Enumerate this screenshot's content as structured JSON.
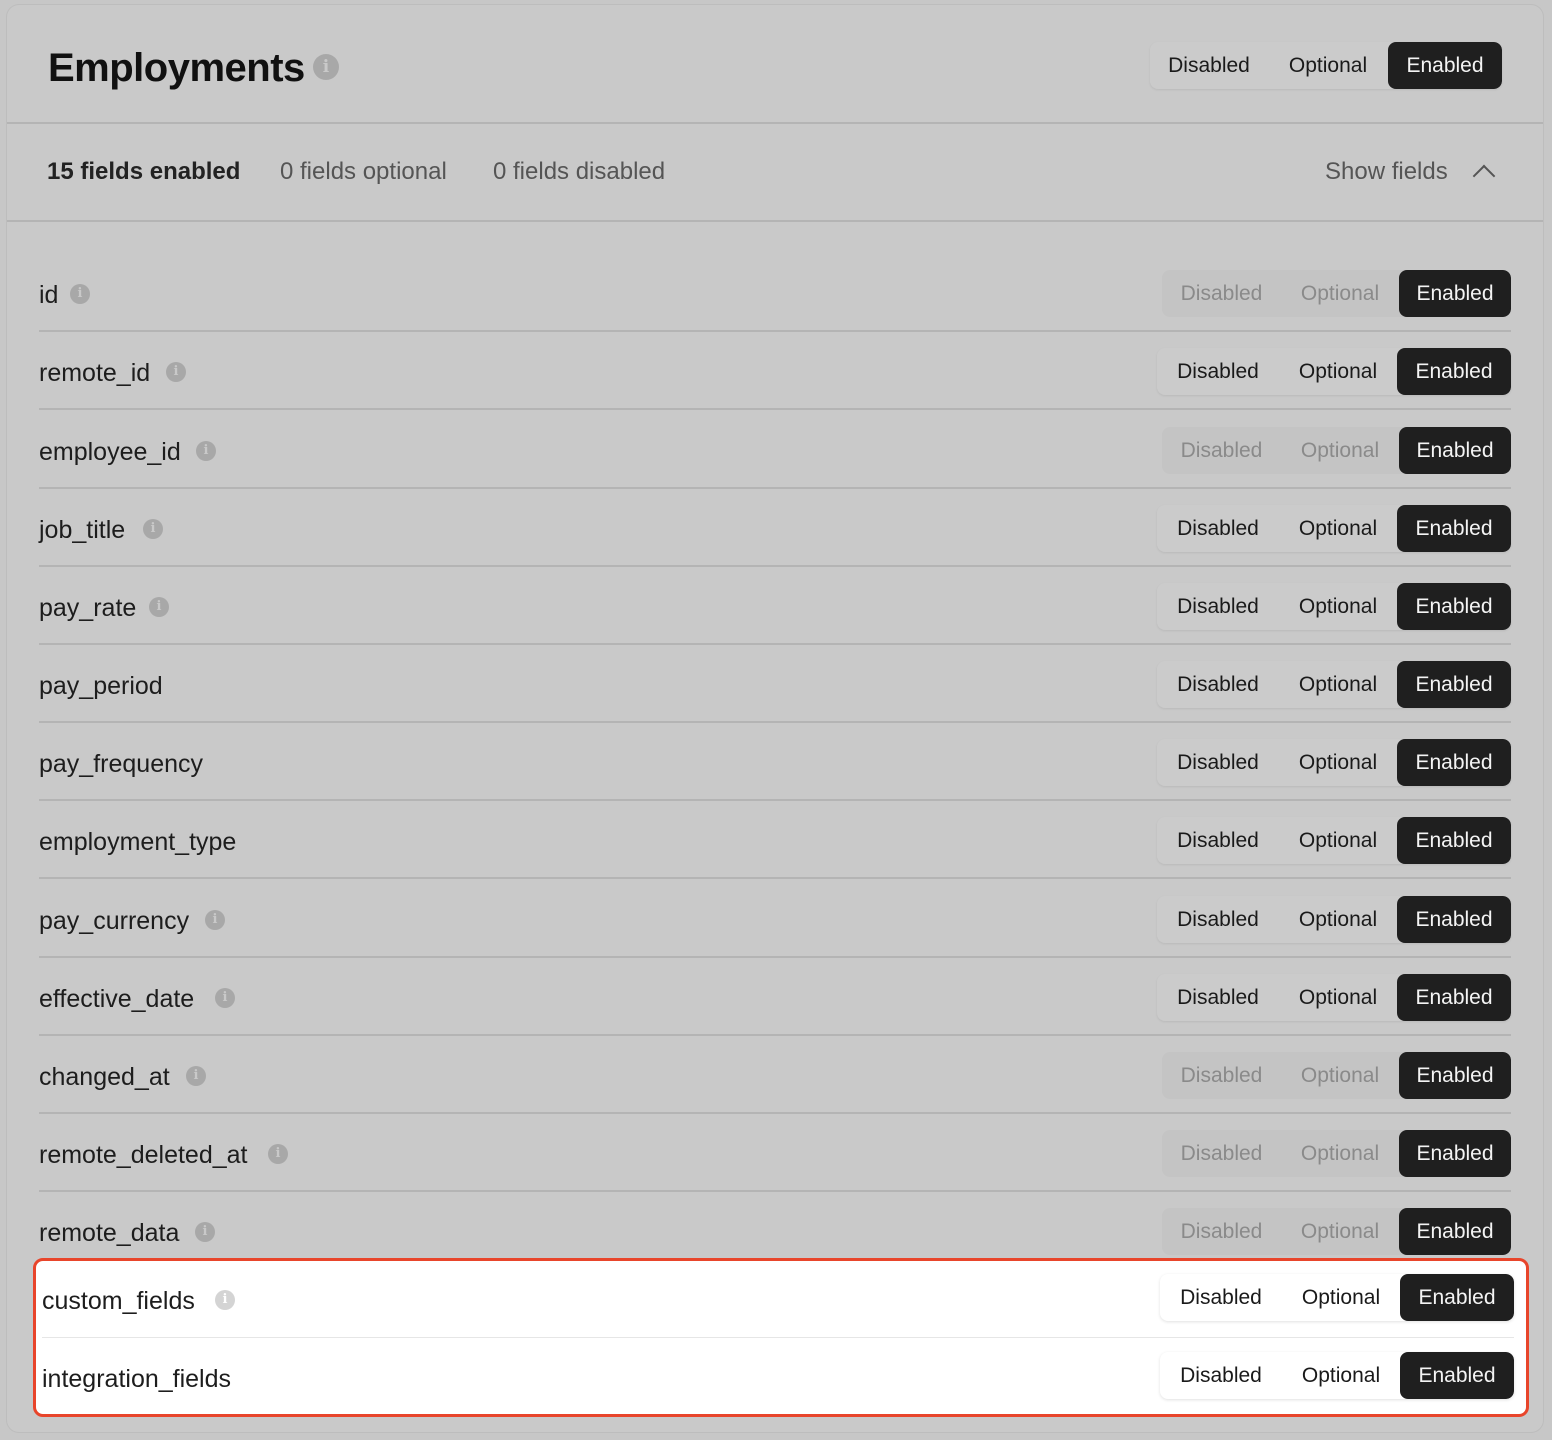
{
  "header": {
    "title": "Employments",
    "info_icon": "info-icon",
    "mode_options": [
      "Disabled",
      "Optional",
      "Enabled"
    ],
    "selected_mode": "Enabled"
  },
  "summary": {
    "enabled": "15 fields enabled",
    "optional": "0 fields optional",
    "disabled": "0 fields disabled",
    "toggle_label": "Show fields",
    "toggle_icon": "chevron-up-icon"
  },
  "options": {
    "disabled": "Disabled",
    "optional": "Optional",
    "enabled": "Enabled"
  },
  "fields": [
    {
      "name": "id",
      "info": true,
      "locked": true,
      "selected": "Enabled"
    },
    {
      "name": "remote_id",
      "info": true,
      "locked": false,
      "selected": "Enabled"
    },
    {
      "name": "employee_id",
      "info": true,
      "locked": true,
      "selected": "Enabled"
    },
    {
      "name": "job_title",
      "info": true,
      "locked": false,
      "selected": "Enabled"
    },
    {
      "name": "pay_rate",
      "info": true,
      "locked": false,
      "selected": "Enabled"
    },
    {
      "name": "pay_period",
      "info": false,
      "locked": false,
      "selected": "Enabled"
    },
    {
      "name": "pay_frequency",
      "info": false,
      "locked": false,
      "selected": "Enabled"
    },
    {
      "name": "employment_type",
      "info": false,
      "locked": false,
      "selected": "Enabled"
    },
    {
      "name": "pay_currency",
      "info": true,
      "locked": false,
      "selected": "Enabled"
    },
    {
      "name": "effective_date",
      "info": true,
      "locked": false,
      "selected": "Enabled"
    },
    {
      "name": "changed_at",
      "info": true,
      "locked": true,
      "selected": "Enabled"
    },
    {
      "name": "remote_deleted_at",
      "info": true,
      "locked": true,
      "selected": "Enabled"
    },
    {
      "name": "remote_data",
      "info": true,
      "locked": true,
      "selected": "Enabled"
    }
  ],
  "highlighted_fields": [
    {
      "name": "custom_fields",
      "info": true,
      "locked": false,
      "selected": "Enabled"
    },
    {
      "name": "integration_fields",
      "info": false,
      "locked": false,
      "selected": "Enabled"
    }
  ],
  "colors": {
    "background": "#c9c9c9",
    "selected_segment": "#1f1f1f",
    "highlight_border": "#e8452b",
    "highlight_fill": "#ffffff"
  }
}
